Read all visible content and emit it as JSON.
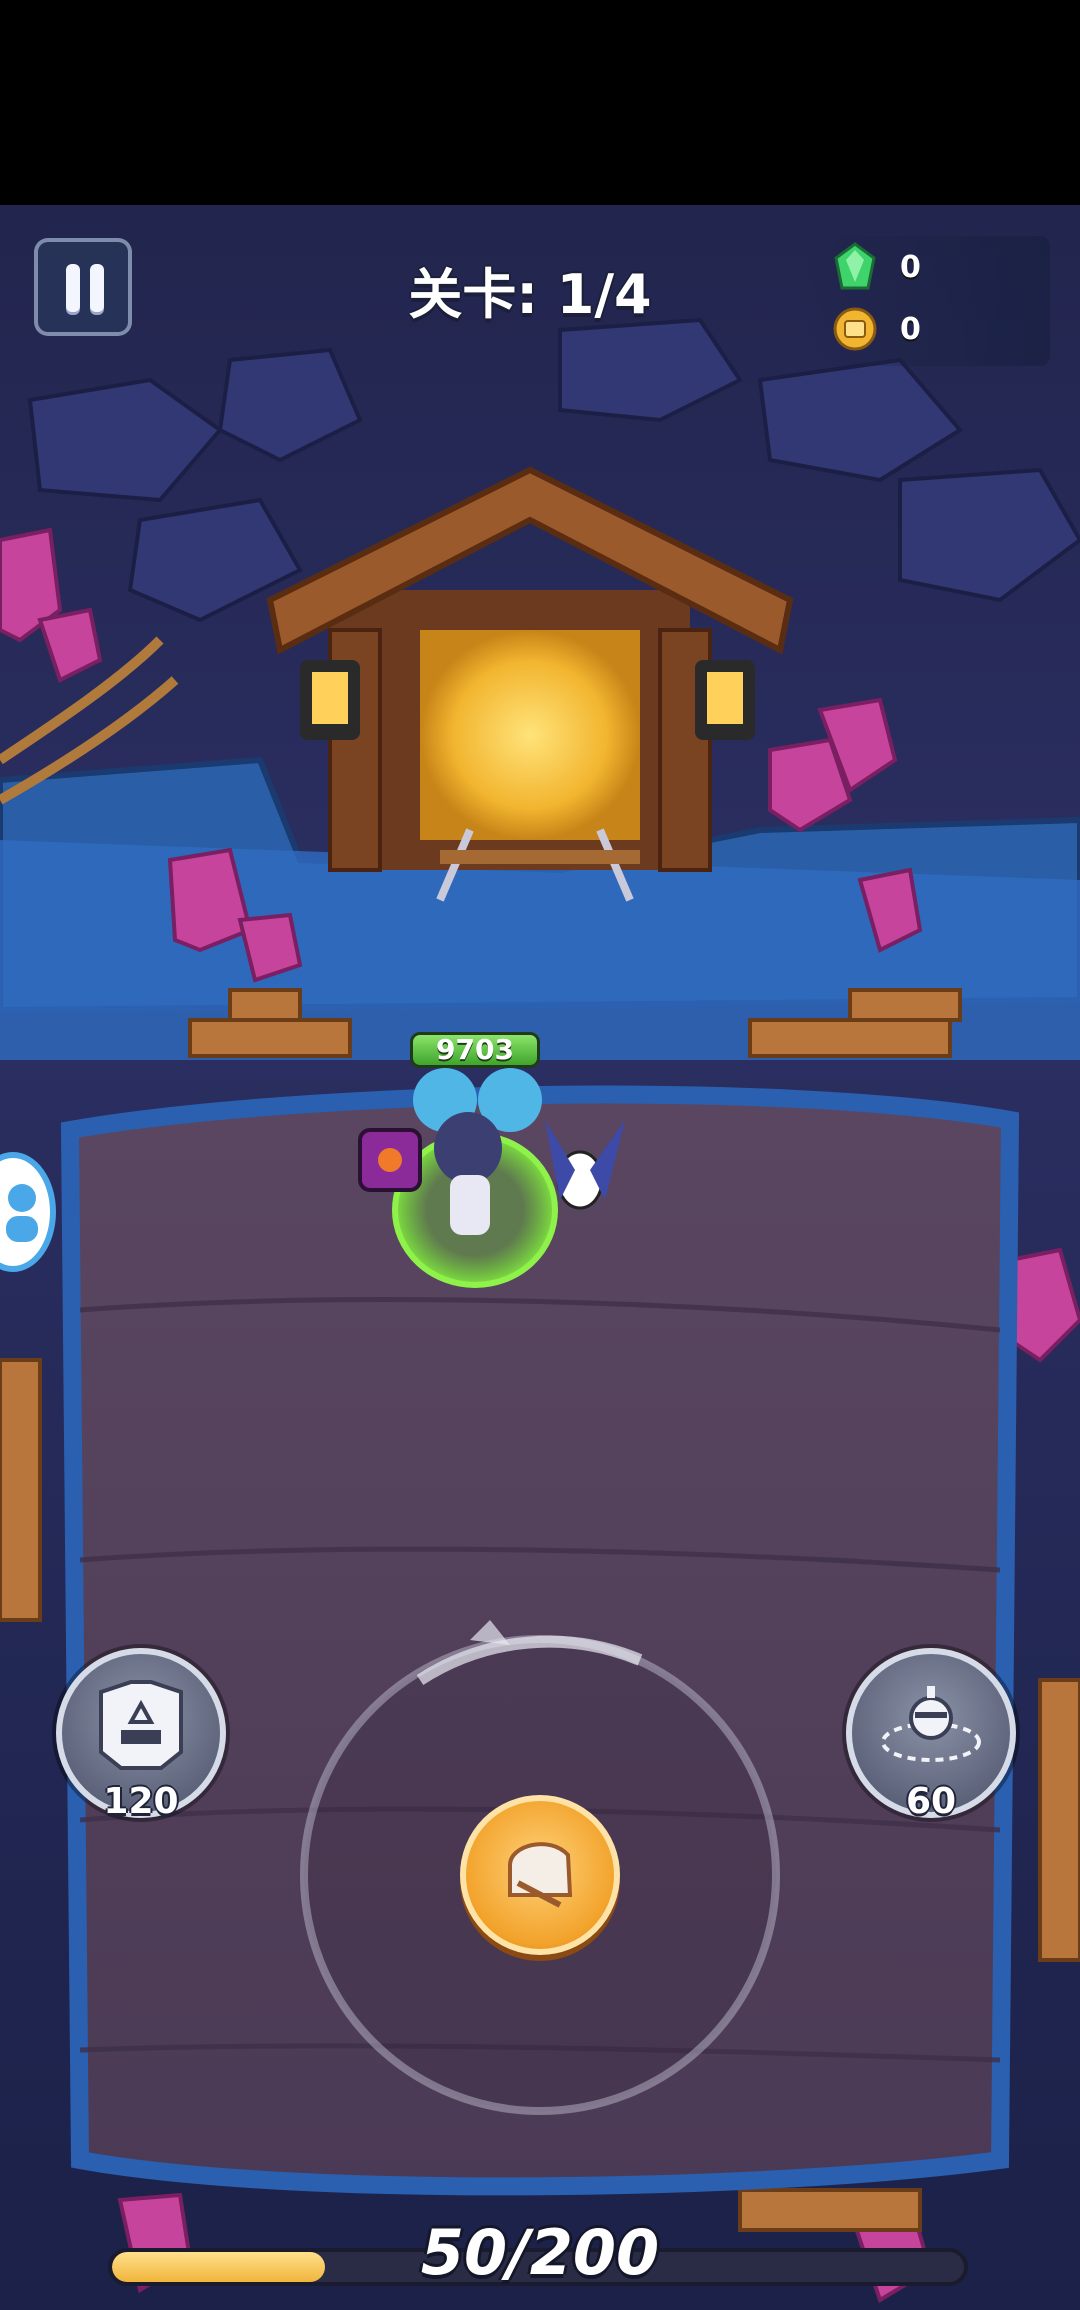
{
  "hud": {
    "level_label": "关卡: 1/4",
    "currency": {
      "gems": "0",
      "coins": "0"
    },
    "pause_icon": "pause-icon"
  },
  "player": {
    "hp": "9703"
  },
  "skills": {
    "left_value": "120",
    "left_icon": "shield-mech-icon",
    "right_value": "60",
    "right_icon": "spinning-trap-icon",
    "center_icon": "fist-attack-icon"
  },
  "experience": {
    "label": "50/200",
    "progress": 0.25
  },
  "colors": {
    "gem": "#3fd46b",
    "coin": "#f2b531",
    "hp_bar": "#4fc23a",
    "exp_fill": "#f0b53c",
    "attack_button": "#f2a22a",
    "player_ring": "#7ee43a",
    "crystal": "#c7449c"
  }
}
